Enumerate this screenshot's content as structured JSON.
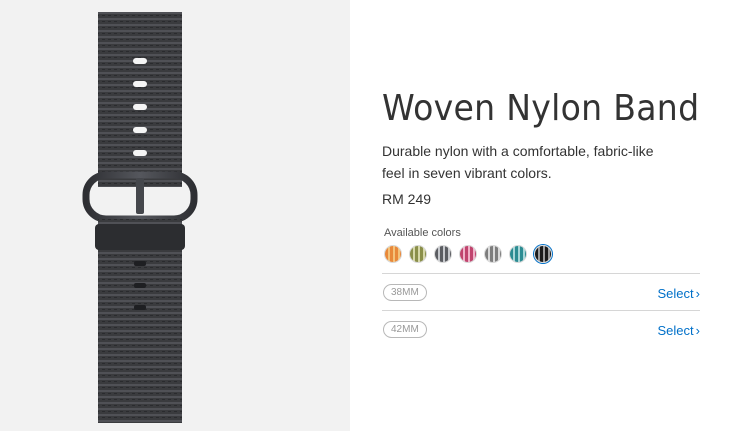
{
  "product": {
    "title": "Woven Nylon Band",
    "description": "Durable nylon with a comfortable, fabric-like feel in seven vibrant colors.",
    "price": "RM 249"
  },
  "colors": {
    "label": "Available colors",
    "swatches": [
      {
        "name": "orange",
        "colors": [
          "#e8893a",
          "#f4c27a"
        ]
      },
      {
        "name": "olive",
        "colors": [
          "#8a8f4a",
          "#d6d7a8"
        ]
      },
      {
        "name": "gray",
        "colors": [
          "#5b5d62",
          "#c6c8cc"
        ]
      },
      {
        "name": "pink",
        "colors": [
          "#c0446e",
          "#f0b1c8"
        ]
      },
      {
        "name": "silver",
        "colors": [
          "#7d7d7d",
          "#d9d9d9"
        ]
      },
      {
        "name": "teal",
        "colors": [
          "#2c8c92",
          "#a7d6d8"
        ]
      },
      {
        "name": "black",
        "colors": [
          "#1b1b1b",
          "#9a9a9a"
        ],
        "selected": true
      }
    ]
  },
  "sizes": [
    {
      "badge": "38MM",
      "action": "Select",
      "chevron": "›"
    },
    {
      "badge": "42MM",
      "action": "Select",
      "chevron": "›"
    }
  ],
  "accent_color": "#0070c9"
}
